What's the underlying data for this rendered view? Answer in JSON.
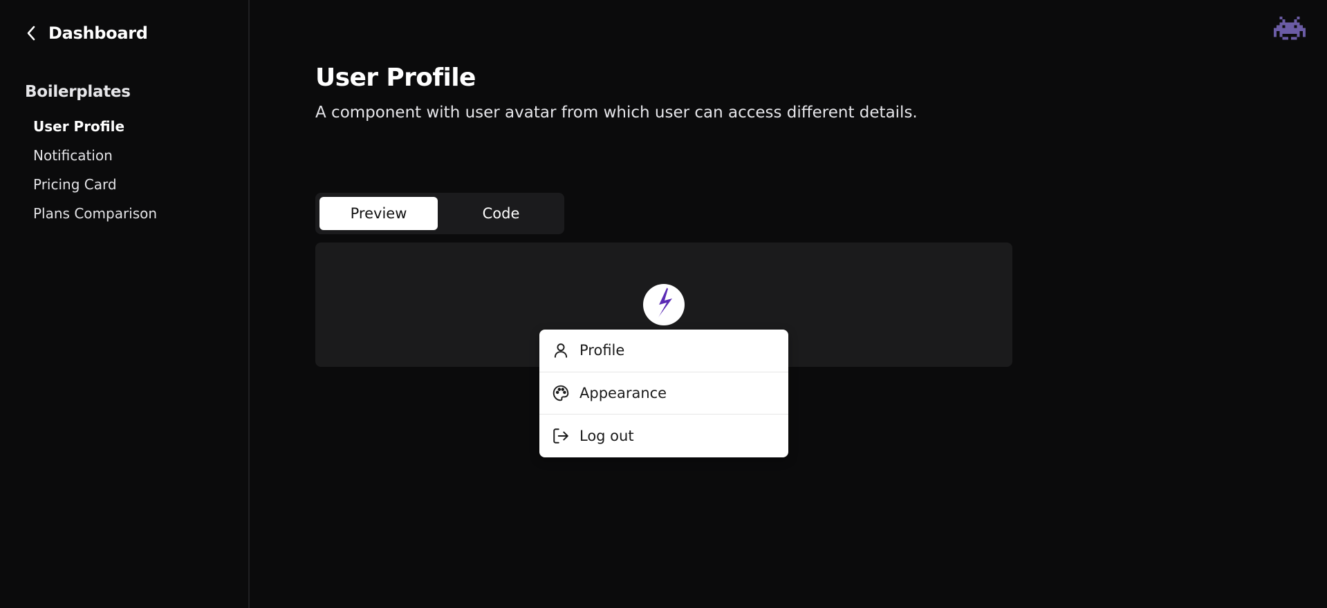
{
  "sidebar": {
    "back_label": "Dashboard",
    "section_title": "Boilerplates",
    "items": [
      {
        "label": "User Profile",
        "active": true
      },
      {
        "label": "Notification",
        "active": false
      },
      {
        "label": "Pricing Card",
        "active": false
      },
      {
        "label": "Plans Comparison",
        "active": false
      }
    ]
  },
  "header": {
    "icon": "space-invader-icon",
    "icon_color": "#6b5ca5"
  },
  "main": {
    "title": "User Profile",
    "description": "A component with user avatar from which user can access different details.",
    "tabs": [
      {
        "label": "Preview",
        "active": true
      },
      {
        "label": "Code",
        "active": false
      }
    ],
    "preview": {
      "avatar_icon": "lightning-bolt-icon",
      "avatar_color": "#5b2bb5",
      "menu": [
        {
          "label": "Profile",
          "icon": "user-icon"
        },
        {
          "label": "Appearance",
          "icon": "palette-icon"
        },
        {
          "label": "Log out",
          "icon": "logout-icon"
        }
      ]
    }
  }
}
